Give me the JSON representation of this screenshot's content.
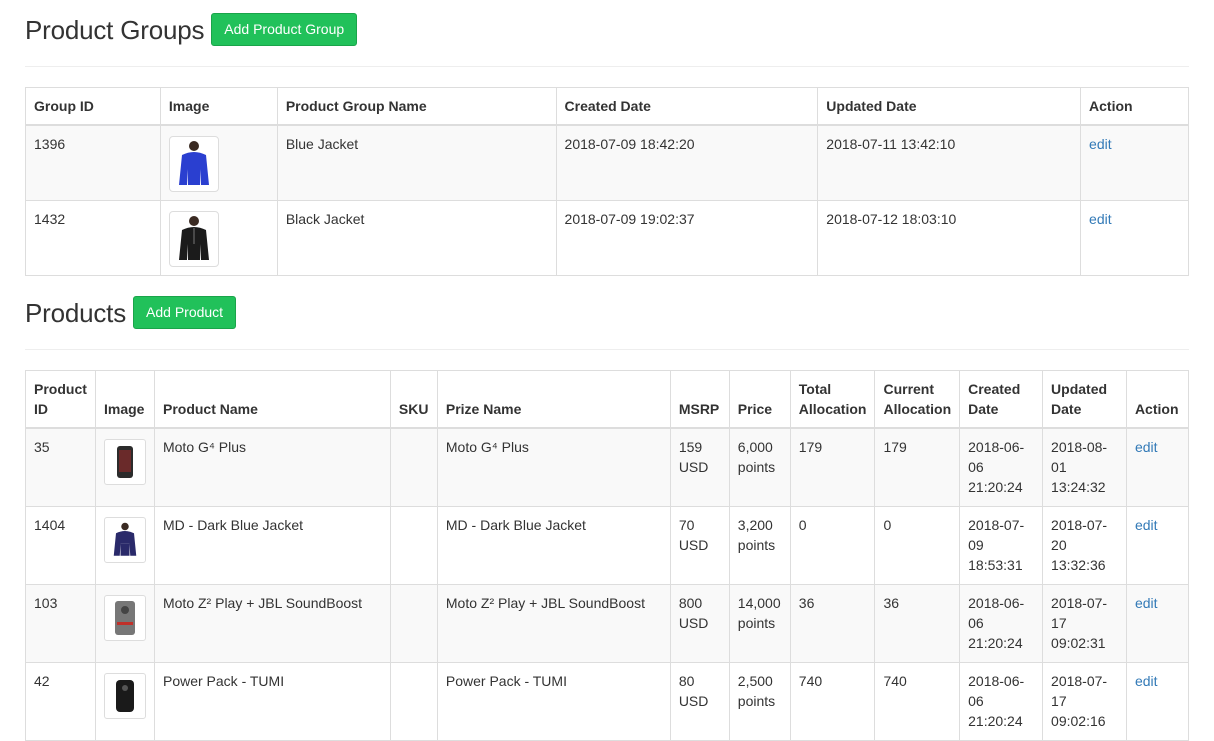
{
  "groups_section": {
    "title": "Product Groups",
    "add_button": "Add Product Group",
    "columns": [
      "Group ID",
      "Image",
      "Product Group Name",
      "Created Date",
      "Updated Date",
      "Action"
    ],
    "rows": [
      {
        "id": "1396",
        "image_icon": "blue-jacket-thumbnail",
        "name": "Blue Jacket",
        "created": "2018-07-09 18:42:20",
        "updated": "2018-07-11 13:42:10",
        "action": "edit"
      },
      {
        "id": "1432",
        "image_icon": "black-jacket-thumbnail",
        "name": "Black Jacket",
        "created": "2018-07-09 19:02:37",
        "updated": "2018-07-12 18:03:10",
        "action": "edit"
      }
    ]
  },
  "products_section": {
    "title": "Products",
    "add_button": "Add Product",
    "columns": {
      "id_1": "Product",
      "id_2": "ID",
      "image": "Image",
      "name": "Product Name",
      "sku": "SKU",
      "prize": "Prize Name",
      "msrp": "MSRP",
      "price": "Price",
      "total_1": "Total",
      "total_2": "Allocation",
      "current_1": "Current",
      "current_2": "Allocation",
      "created_1": "Created",
      "created_2": "Date",
      "updated_1": "Updated",
      "updated_2": "Date",
      "action": "Action"
    },
    "rows": [
      {
        "id": "35",
        "image_icon": "phone-thumbnail",
        "name": "Moto G⁴ Plus",
        "sku": "",
        "prize": "Moto G⁴ Plus",
        "msrp_1": "159",
        "msrp_2": "USD",
        "price_1": "6,000",
        "price_2": "points",
        "total": "179",
        "current": "179",
        "created_1": "2018-06-",
        "created_2": "06",
        "created_3": "21:20:24",
        "updated_1": "2018-08-",
        "updated_2": "01",
        "updated_3": "13:24:32",
        "action": "edit"
      },
      {
        "id": "1404",
        "image_icon": "dark-blue-jacket-thumbnail",
        "name": "MD - Dark Blue Jacket",
        "sku": "",
        "prize": "MD - Dark Blue Jacket",
        "msrp_1": "70",
        "msrp_2": "USD",
        "price_1": "3,200",
        "price_2": "points",
        "total": "0",
        "current": "0",
        "created_1": "2018-07-",
        "created_2": "09",
        "created_3": "18:53:31",
        "updated_1": "2018-07-",
        "updated_2": "20",
        "updated_3": "13:32:36",
        "action": "edit"
      },
      {
        "id": "103",
        "image_icon": "phone-speaker-thumbnail",
        "name": "Moto Z² Play + JBL SoundBoost",
        "sku": "",
        "prize": "Moto Z² Play + JBL SoundBoost",
        "msrp_1": "800",
        "msrp_2": "USD",
        "price_1": "14,000",
        "price_2": "points",
        "total": "36",
        "current": "36",
        "created_1": "2018-06-",
        "created_2": "06",
        "created_3": "21:20:24",
        "updated_1": "2018-07-",
        "updated_2": "17",
        "updated_3": "09:02:31",
        "action": "edit"
      },
      {
        "id": "42",
        "image_icon": "power-pack-thumbnail",
        "name": "Power Pack - TUMI",
        "sku": "",
        "prize": "Power Pack - TUMI",
        "msrp_1": "80",
        "msrp_2": "USD",
        "price_1": "2,500",
        "price_2": "points",
        "total": "740",
        "current": "740",
        "created_1": "2018-06-",
        "created_2": "06",
        "created_3": "21:20:24",
        "updated_1": "2018-07-",
        "updated_2": "17",
        "updated_3": "09:02:16",
        "action": "edit"
      }
    ]
  },
  "colors": {
    "accent_green": "#21c15a",
    "link_blue": "#337ab7",
    "stripe": "#f9f9f9",
    "border": "#ddd"
  }
}
